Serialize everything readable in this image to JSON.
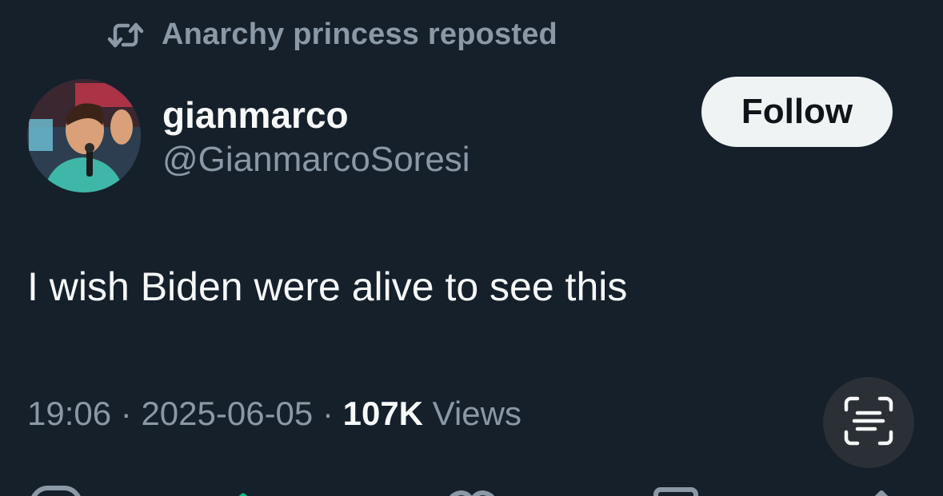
{
  "repost_banner": {
    "icon": "repost-icon",
    "text": "Anarchy princess reposted"
  },
  "author": {
    "display_name": "gianmarco",
    "handle": "@GianmarcoSoresi",
    "avatar": "profile-photo"
  },
  "follow_button": {
    "label": "Follow"
  },
  "tweet": {
    "text": "I wish Biden were alive to see this"
  },
  "meta": {
    "time": "19:06",
    "separator": " · ",
    "date": "2025-06-05",
    "views_count": "107K",
    "views_label": " Views"
  },
  "actions": {
    "reply_icon": "reply-icon",
    "repost_icon": "repost-icon",
    "like_icon": "heart-icon",
    "bookmark_icon": "bookmark-icon",
    "share_icon": "share-icon",
    "reposted_color": "#00ba7c"
  },
  "scan_button": {
    "icon": "text-scan-icon"
  },
  "colors": {
    "background": "#15202b",
    "primary_text": "#f7f9f9",
    "secondary_text": "#8b98a5",
    "follow_bg": "#eff3f4"
  }
}
